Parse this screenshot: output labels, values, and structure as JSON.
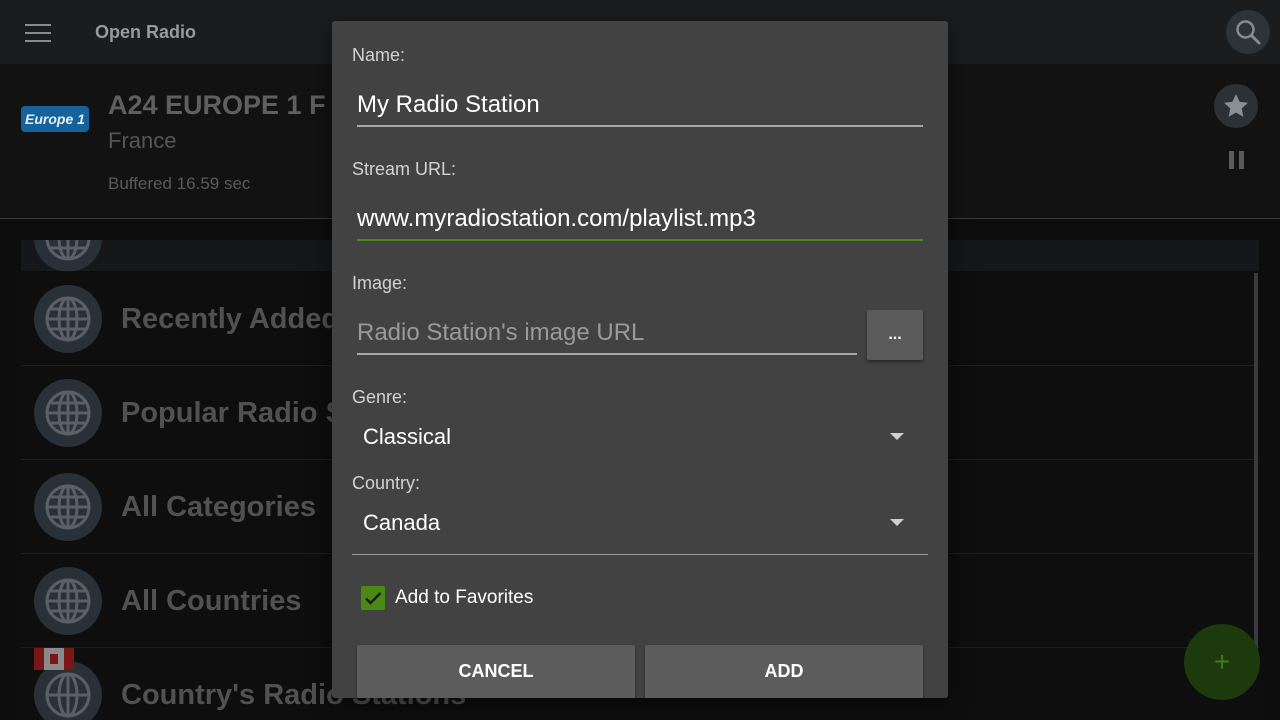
{
  "app": {
    "title": "Open Radio"
  },
  "now_playing": {
    "logo_text": "Europe 1",
    "title": "A24  EUROPE 1 F",
    "country": "France",
    "buffer": "Buffered 16.59 sec"
  },
  "list": {
    "items": [
      {
        "label": "Recently Added"
      },
      {
        "label": "Popular Radio St"
      },
      {
        "label": "All Categories"
      },
      {
        "label": "All Countries"
      },
      {
        "label": "Country's Radio Stations"
      }
    ]
  },
  "dialog": {
    "name_label": "Name:",
    "name_value": "My Radio Station",
    "url_label": "Stream URL:",
    "url_value": "www.myradiostation.com/playlist.mp3",
    "image_label": "Image:",
    "image_placeholder": "Radio Station's image URL",
    "browse_label": "...",
    "genre_label": "Genre:",
    "genre_value": "Classical",
    "country_label": "Country:",
    "country_value": "Canada",
    "favorites_label": "Add to Favorites",
    "favorites_checked": true,
    "cancel_label": "CANCEL",
    "add_label": "ADD"
  },
  "fab": {
    "symbol": "+"
  },
  "colors": {
    "accent": "#4a8a14",
    "dialog_bg": "#424242",
    "appbar_bg": "#1a1c1e"
  },
  "icons": [
    "menu-icon",
    "search-icon",
    "star-icon",
    "pause-icon",
    "globe-icon",
    "canada-flag-icon",
    "chevron-down-icon",
    "check-icon",
    "plus-icon"
  ]
}
